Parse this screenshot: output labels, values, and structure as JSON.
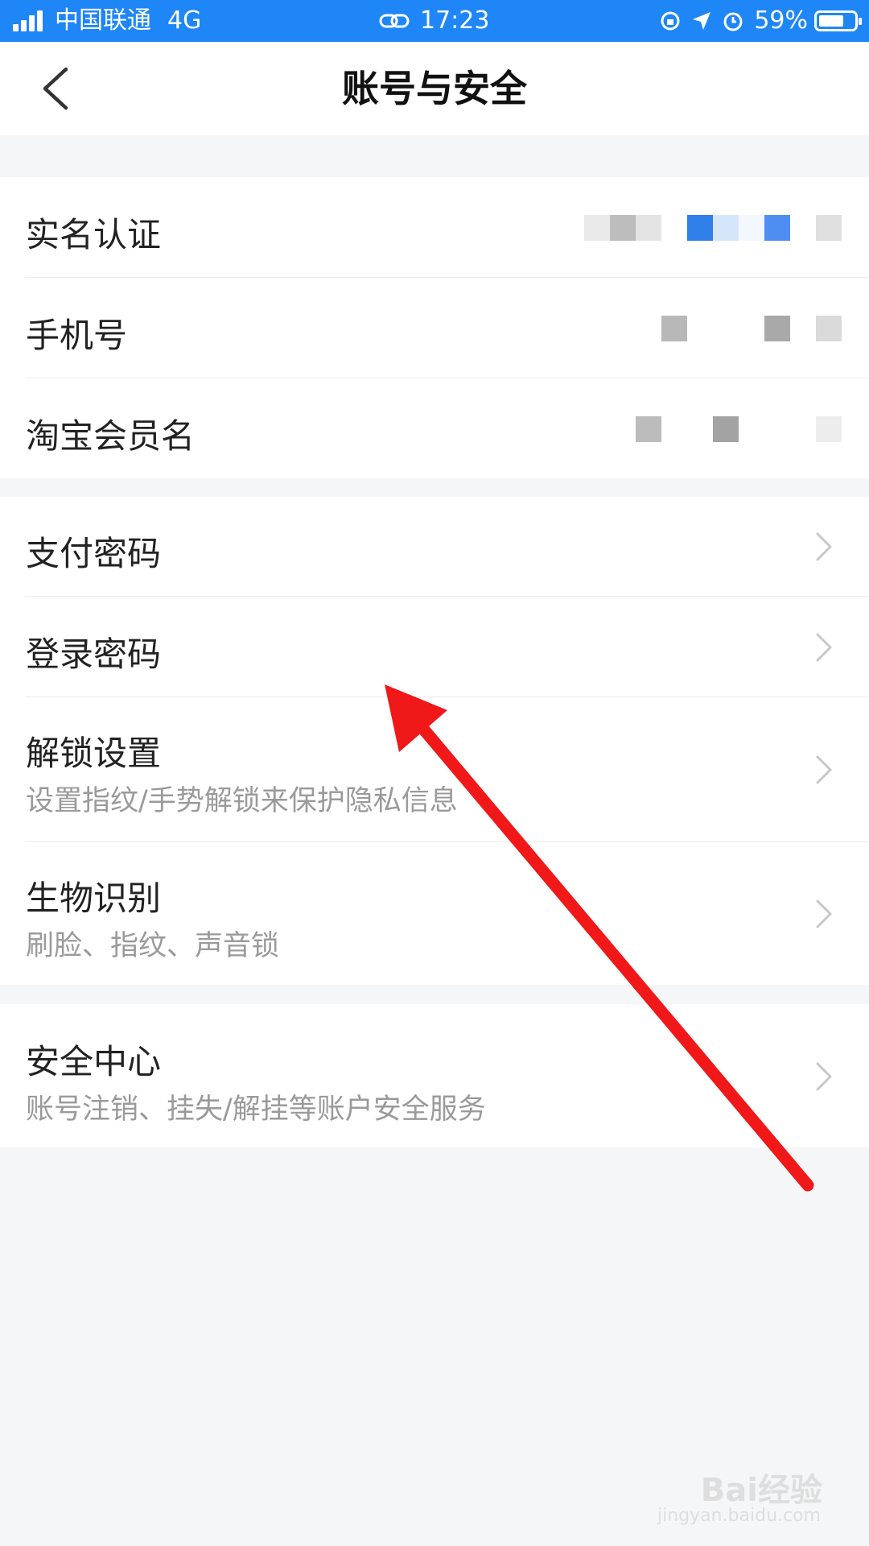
{
  "status_bar": {
    "carrier": "中国联通",
    "network": "4G",
    "time": "17:23",
    "battery": "59%",
    "battery_level": 0.59,
    "bar_color": "#1e86f7"
  },
  "header": {
    "title": "账号与安全",
    "back_icon": "chevron-left-icon"
  },
  "groups": [
    {
      "items": [
        {
          "title": "实名认证",
          "value": "(masked)"
        },
        {
          "title": "手机号",
          "value": "(masked)"
        },
        {
          "title": "淘宝会员名",
          "value": "(masked)"
        }
      ]
    },
    {
      "items": [
        {
          "title": "支付密码"
        },
        {
          "title": "登录密码"
        },
        {
          "title": "解锁设置",
          "subtitle": "设置指纹/手势解锁来保护隐私信息"
        },
        {
          "title": "生物识别",
          "subtitle": "刷脸、指纹、声音锁"
        }
      ]
    },
    {
      "items": [
        {
          "title": "安全中心",
          "subtitle": "账号注销、挂失/解挂等账户安全服务"
        }
      ]
    }
  ],
  "watermark": {
    "brand": "Bai经验",
    "url": "jingyan.baidu.com"
  },
  "colors": {
    "annotation_arrow": "#f01818",
    "background": "#f5f6f7",
    "chevron": "#c7c7cc"
  }
}
